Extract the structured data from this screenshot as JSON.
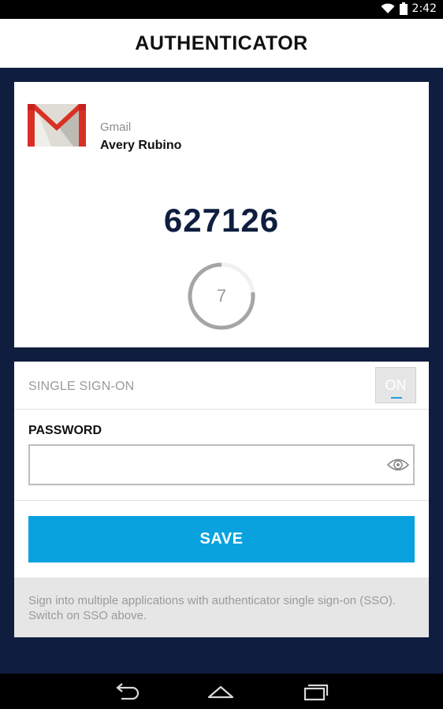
{
  "status_bar": {
    "time": "2:42",
    "icons": [
      "wifi-icon",
      "battery-icon"
    ]
  },
  "app_bar": {
    "title": "AUTHENTICATOR"
  },
  "account": {
    "icon": "gmail-logo",
    "service": "Gmail",
    "name": "Avery Rubino",
    "code": "627126",
    "timer_seconds": "7",
    "timer_fraction": 0.23
  },
  "sso": {
    "label": "SINGLE SIGN-ON",
    "toggle_label": "ON",
    "password_label": "PASSWORD",
    "password_value": "",
    "password_placeholder": "",
    "save_label": "SAVE",
    "help_text": "Sign into multiple applications with authenticator single sign-on (SSO). Switch on SSO above."
  },
  "nav_bar": {
    "buttons": [
      "back-icon",
      "home-icon",
      "recents-icon"
    ]
  },
  "colors": {
    "background": "#0f1e3f",
    "accent": "#0aa2de",
    "gmail_red": "#d93025"
  }
}
